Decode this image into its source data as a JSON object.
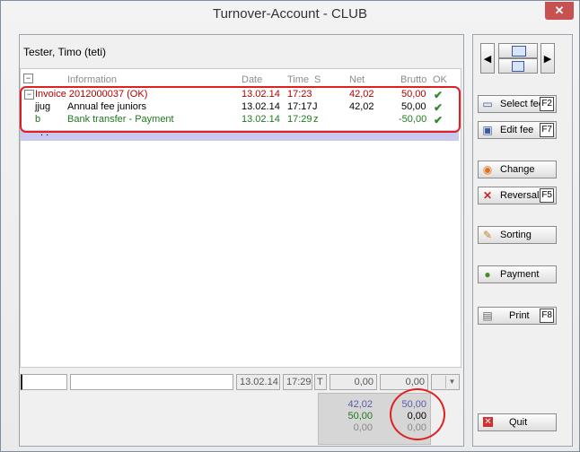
{
  "window": {
    "title": "Turnover-Account - CLUB",
    "close": "✕"
  },
  "user": "Tester, Timo (teti)",
  "columns": {
    "information": "Information",
    "date": "Date",
    "time": "Time",
    "s": "S",
    "net": "Net",
    "brutto": "Brutto",
    "ok": "OK"
  },
  "rows": [
    {
      "code": "",
      "info": "Invoice 2012000037 (OK)",
      "date": "13.02.14",
      "time": "17:23",
      "s": "",
      "net": "42,02",
      "brutto": "50,00",
      "ok": "✔"
    },
    {
      "code": "jjug",
      "info": "Annual fee juniors",
      "date": "13.02.14",
      "time": "17:17",
      "s": "J",
      "net": "42,02",
      "brutto": "50,00",
      "ok": "✔"
    },
    {
      "code": "b",
      "info": "Bank transfer - Payment",
      "date": "13.02.14",
      "time": "17:29",
      "s": "z",
      "net": "",
      "brutto": "-50,00",
      "ok": "✔"
    }
  ],
  "selected_row": {
    "dots": ". ."
  },
  "entry": {
    "code": "",
    "info": "",
    "date": "13.02.14",
    "time": "17:29",
    "s": "T",
    "net": "0,00",
    "brutto": "0,00"
  },
  "totals": {
    "left": [
      "42,02",
      "50,00",
      "0,00"
    ],
    "right": [
      "50,00",
      "0,00",
      "0,00"
    ]
  },
  "buttons": {
    "select_fee": "Select fee",
    "select_fee_key": "F2",
    "edit_fee": "Edit fee",
    "edit_fee_key": "F7",
    "change": "Change",
    "reversal": "Reversal",
    "reversal_key": "F5",
    "sorting": "Sorting",
    "payment": "Payment",
    "print": "Print",
    "print_key": "F8",
    "quit": "Quit"
  },
  "colors": {
    "highlight": "#e02020",
    "invoice": "#b00000",
    "payment": "#207820",
    "selection": "#c9c9ef"
  }
}
